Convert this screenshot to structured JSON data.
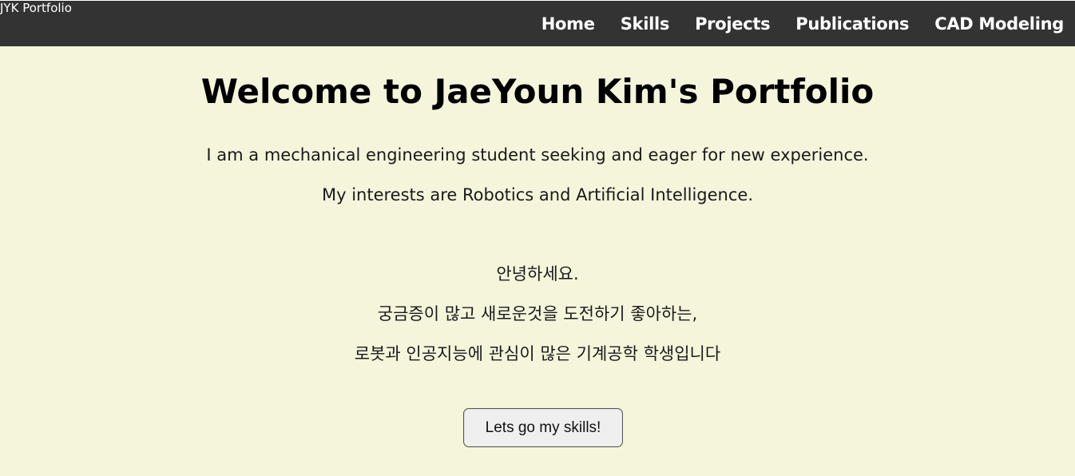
{
  "navbar": {
    "brand": "JYK Portfolio",
    "links": [
      {
        "label": "Home"
      },
      {
        "label": "Skills"
      },
      {
        "label": "Projects"
      },
      {
        "label": "Publications"
      },
      {
        "label": "CAD Modeling"
      }
    ]
  },
  "hero": {
    "title": "Welcome to JaeYoun Kim's Portfolio",
    "intro_en": [
      "I am a mechanical engineering student seeking and eager for new experience.",
      "My interests are Robotics and Artificial Intelligence."
    ],
    "intro_ko": [
      "안녕하세요.",
      "궁금증이 많고 새로운것을 도전하기 좋아하는,",
      "로봇과 인공지능에 관심이 많은 기계공학 학생입니다"
    ],
    "cta_label": "Lets go my skills!"
  },
  "colors": {
    "navbar_bg": "#333333",
    "page_bg": "#f5f5dc",
    "nav_text": "#ffffff"
  }
}
